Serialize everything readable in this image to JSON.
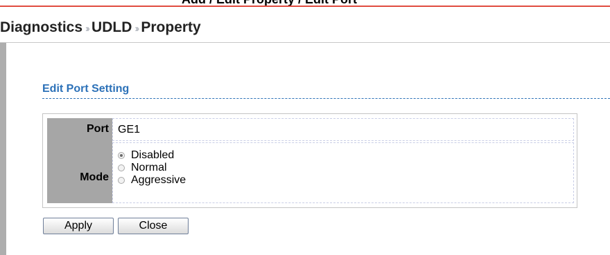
{
  "window": {
    "title": "Add / Edit Property / Edit Port"
  },
  "breadcrumb": {
    "items": [
      "Diagnostics",
      "UDLD",
      "Property"
    ],
    "separator": "››"
  },
  "section": {
    "title": "Edit Port Setting"
  },
  "form": {
    "port_label": "Port",
    "port_value": "GE1",
    "mode_label": "Mode",
    "mode_options": [
      {
        "label": "Disabled",
        "selected": true
      },
      {
        "label": "Normal",
        "selected": false
      },
      {
        "label": "Aggressive",
        "selected": false
      }
    ]
  },
  "buttons": {
    "apply": "Apply",
    "close": "Close"
  },
  "colors": {
    "accent_blue": "#2c71b8",
    "top_rule": "#e04b3f",
    "label_gray": "#a6a6a6"
  }
}
